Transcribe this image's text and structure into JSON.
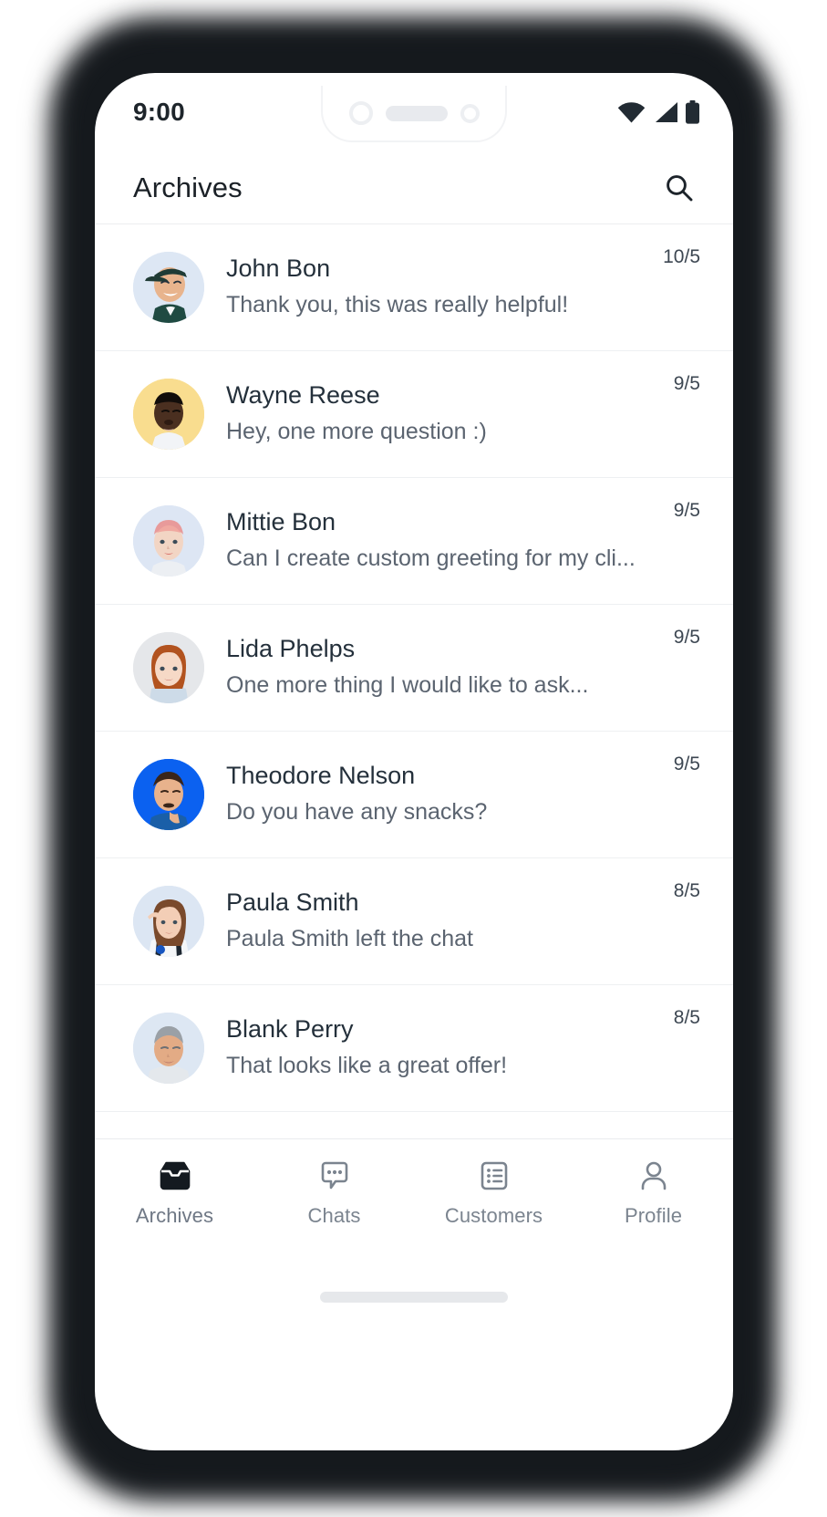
{
  "status_bar": {
    "time": "9:00",
    "icons": [
      "wifi-icon",
      "cellular-signal-icon",
      "battery-icon"
    ]
  },
  "header": {
    "title": "Archives",
    "search_icon": "search-icon"
  },
  "chats": [
    {
      "name": "John Bon",
      "preview": "Thank you, this was really helpful!",
      "date": "10/5",
      "avatar_bg": "#dde7f4",
      "avatar_kind": "man-cap"
    },
    {
      "name": "Wayne Reese",
      "preview": "Hey, one more question :)",
      "date": "9/5",
      "avatar_bg": "#f9dd8f",
      "avatar_kind": "man-dark"
    },
    {
      "name": "Mittie Bon",
      "preview": "Can I create custom greeting for my cli...",
      "date": "9/5",
      "avatar_bg": "#dde6f4",
      "avatar_kind": "woman-pink-hair"
    },
    {
      "name": "Lida Phelps",
      "preview": "One more thing I would like to ask...",
      "date": "9/5",
      "avatar_bg": "#e5e7ea",
      "avatar_kind": "woman-red-hair"
    },
    {
      "name": "Theodore Nelson",
      "preview": "Do you have any snacks?",
      "date": "9/5",
      "avatar_bg": "#0b61f0",
      "avatar_kind": "man-thinking"
    },
    {
      "name": "Paula Smith",
      "preview": "Paula Smith left the chat",
      "date": "8/5",
      "avatar_bg": "#dce6f3",
      "avatar_kind": "woman-astronaut"
    },
    {
      "name": "Blank Perry",
      "preview": "That looks like a great offer!",
      "date": "8/5",
      "avatar_bg": "#dde7f3",
      "avatar_kind": "man-grey-hair"
    }
  ],
  "bottom_nav": [
    {
      "label": "Archives",
      "icon": "inbox-icon",
      "active": true
    },
    {
      "label": "Chats",
      "icon": "chat-bubble-icon",
      "active": false
    },
    {
      "label": "Customers",
      "icon": "contact-list-icon",
      "active": false
    },
    {
      "label": "Profile",
      "icon": "person-icon",
      "active": false
    }
  ],
  "colors": {
    "active_nav": "#141a20",
    "inactive_nav": "#7b848f",
    "title": "#1b2127",
    "preview": "#5b6470"
  }
}
